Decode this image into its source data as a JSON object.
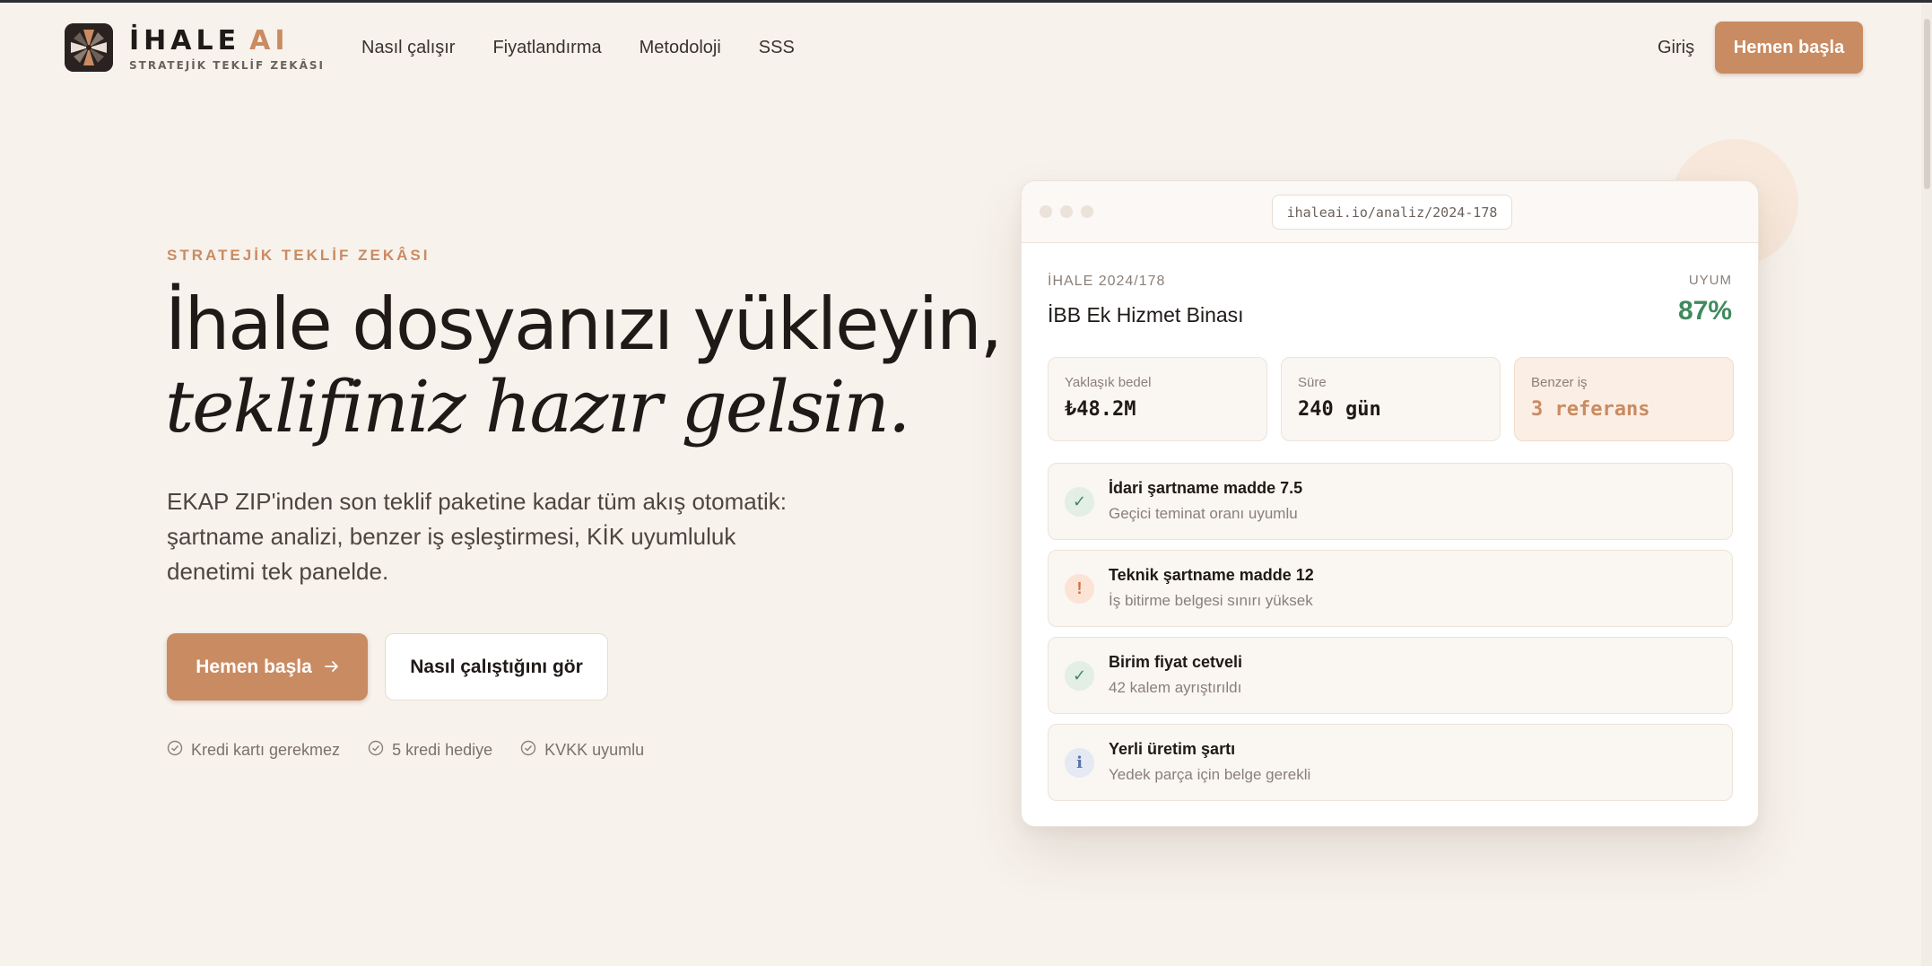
{
  "brand": {
    "name": "İHALE",
    "name_accent": "AI",
    "tagline": "STRATEJİK TEKLİF ZEKÂSI",
    "accent_color": "#c98b62"
  },
  "nav": {
    "links": [
      "Nasıl çalışır",
      "Fiyatlandırma",
      "Metodoloji",
      "SSS"
    ],
    "login": "Giriş",
    "cta": "Hemen başla"
  },
  "hero": {
    "eyebrow": "STRATEJİK TEKLİF ZEKÂSI",
    "headline_line1": "İhale dosyanızı yükleyin,",
    "headline_line2": "teklifiniz hazır gelsin.",
    "lead_line1": "EKAP ZIP'inden son teklif paketine kadar tüm akış otomatik:",
    "lead_line2": "şartname analizi, benzer iş eşleştirmesi, KİK uyumluluk",
    "lead_line3": "denetimi tek panelde.",
    "primary_button": "Hemen başla",
    "primary_button_icon": "arrow-right-icon",
    "secondary_button": "Nasıl çalıştığını gör",
    "perks": [
      "Kredi kartı gerekmez",
      "5 kredi hediye",
      "KVKK uyumlu"
    ]
  },
  "mock": {
    "url": "ihaleai.io/analiz/2024-178",
    "ref": "İHALE 2024/178",
    "title": "İBB Ek Hizmet Binası",
    "uyum_label": "UYUM",
    "uyum_value": "87%",
    "stats": [
      {
        "label": "Yaklaşık bedel",
        "value": "₺48.2M"
      },
      {
        "label": "Süre",
        "value": "240 gün"
      },
      {
        "label": "Benzer iş",
        "value": "3 referans"
      }
    ],
    "checks": [
      {
        "status": "ok",
        "glyph": "✓",
        "title": "İdari şartname madde 7.5",
        "sub": "Geçici teminat oranı uyumlu"
      },
      {
        "status": "warn",
        "glyph": "!",
        "title": "Teknik şartname madde 12",
        "sub": "İş bitirme belgesi sınırı yüksek"
      },
      {
        "status": "ok",
        "glyph": "✓",
        "title": "Birim fiyat cetveli",
        "sub": "42 kalem ayrıştırıldı"
      },
      {
        "status": "info",
        "glyph": "i",
        "title": "Yerli üretim şartı",
        "sub": "Yedek parça için belge gerekli"
      }
    ],
    "colors": {
      "ok": "#3f8a5e",
      "warn": "#d36f45",
      "info": "#5675a6"
    }
  }
}
